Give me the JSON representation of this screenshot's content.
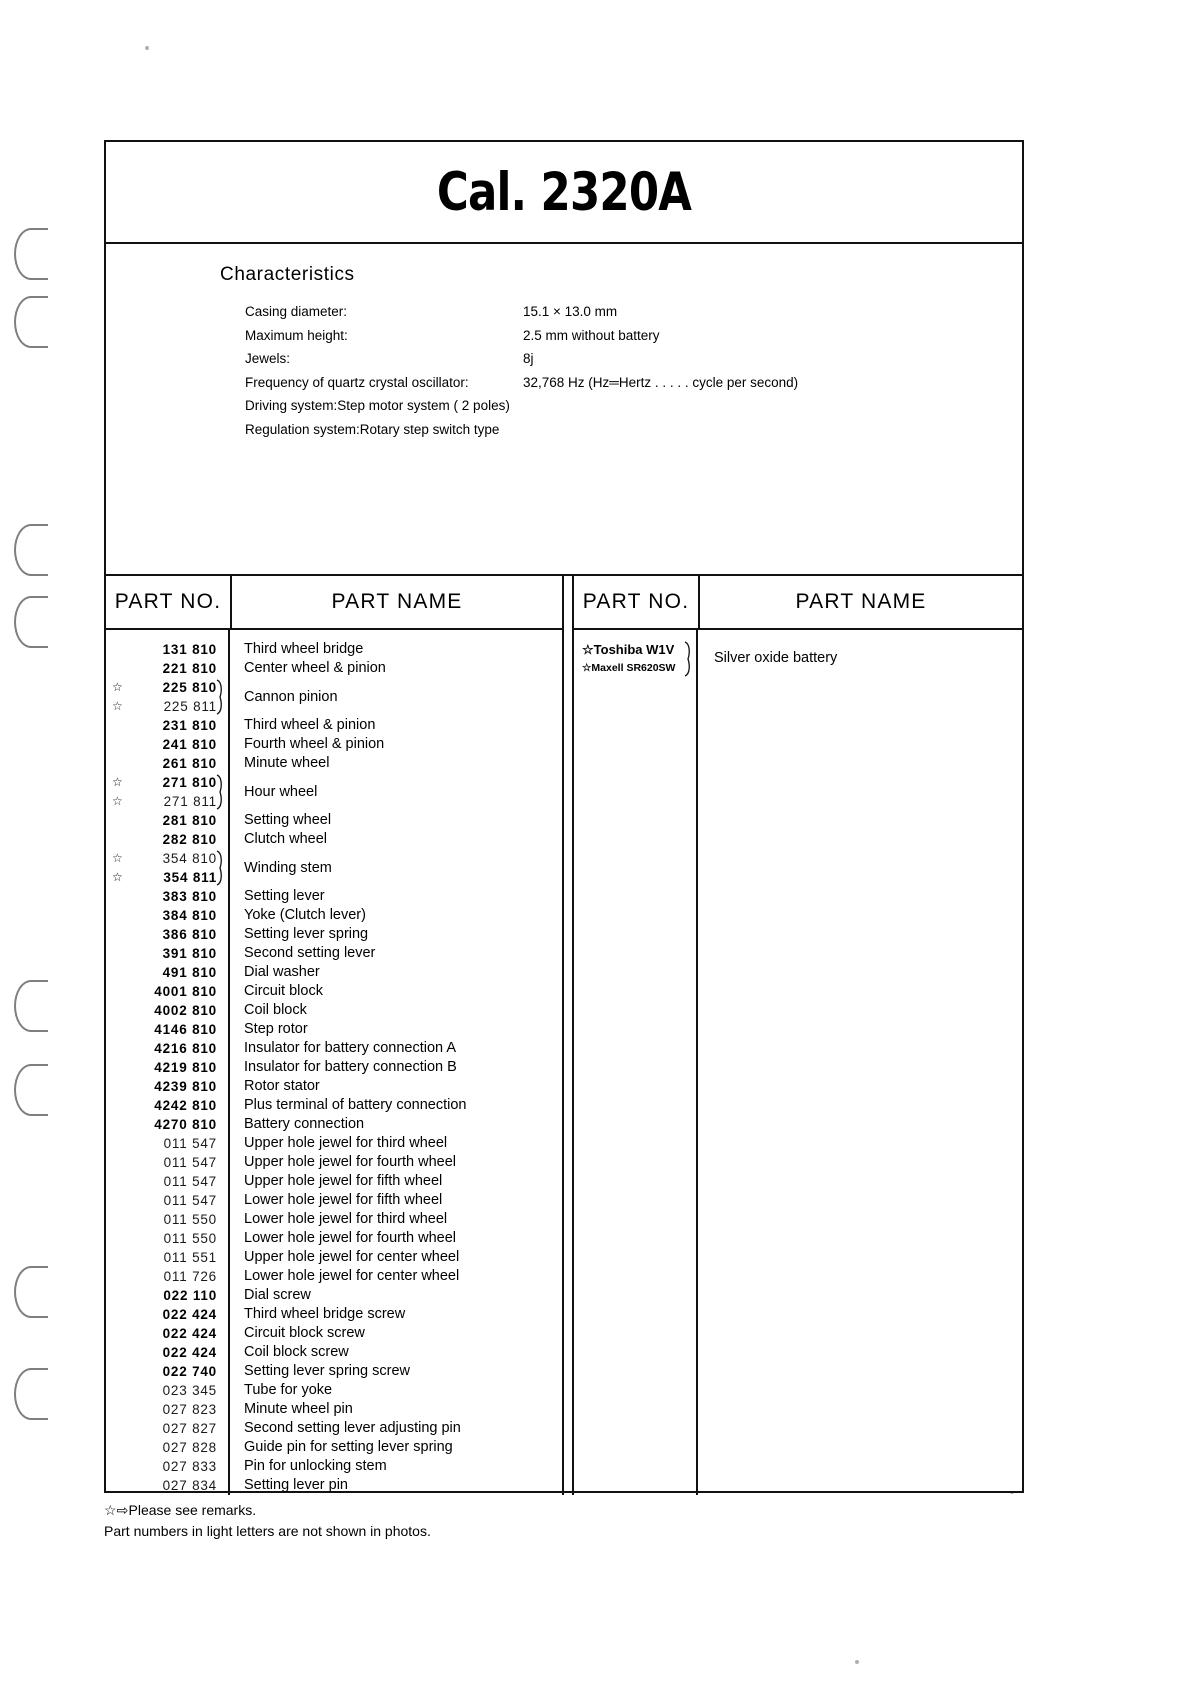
{
  "document": {
    "title": "Cal. 2320A"
  },
  "characteristics": {
    "heading": "Characteristics",
    "rows": [
      {
        "label": "Casing diameter:",
        "value": "15.1 × 13.0 mm",
        "full": false
      },
      {
        "label": "Maximum height:",
        "value": "2.5 mm without battery",
        "full": false
      },
      {
        "label": "Jewels:",
        "value": "8j",
        "full": false
      },
      {
        "label": "Frequency of quartz crystal oscillator:",
        "value": "32,768 Hz (Hz═Hertz . . . . . cycle per second)",
        "full": false
      },
      {
        "label": "Driving system:Step motor system ( 2 poles)",
        "value": "",
        "full": true
      },
      {
        "label": "Regulation system:Rotary step switch type",
        "value": "",
        "full": true
      }
    ]
  },
  "table": {
    "headers": {
      "part_no": "PART NO.",
      "part_name": "PART NAME"
    },
    "left_rows": [
      {
        "numbers": [
          {
            "text": "131 810",
            "weight": "bold",
            "star": false
          }
        ],
        "name": "Third wheel bridge",
        "grouped": false
      },
      {
        "numbers": [
          {
            "text": "221 810",
            "weight": "bold",
            "star": false
          }
        ],
        "name": "Center wheel & pinion",
        "grouped": false
      },
      {
        "numbers": [
          {
            "text": "225 810",
            "weight": "bold",
            "star": true
          },
          {
            "text": "225 811",
            "weight": "light",
            "star": true
          }
        ],
        "name": "Cannon pinion",
        "grouped": true
      },
      {
        "numbers": [
          {
            "text": "231 810",
            "weight": "bold",
            "star": false
          }
        ],
        "name": "Third wheel & pinion",
        "grouped": false
      },
      {
        "numbers": [
          {
            "text": "241 810",
            "weight": "bold",
            "star": false
          }
        ],
        "name": "Fourth wheel & pinion",
        "grouped": false
      },
      {
        "numbers": [
          {
            "text": "261 810",
            "weight": "bold",
            "star": false
          }
        ],
        "name": "Minute wheel",
        "grouped": false
      },
      {
        "numbers": [
          {
            "text": "271 810",
            "weight": "bold",
            "star": true
          },
          {
            "text": "271 811",
            "weight": "light",
            "star": true
          }
        ],
        "name": "Hour wheel",
        "grouped": true
      },
      {
        "numbers": [
          {
            "text": "281 810",
            "weight": "bold",
            "star": false
          }
        ],
        "name": "Setting wheel",
        "grouped": false
      },
      {
        "numbers": [
          {
            "text": "282 810",
            "weight": "bold",
            "star": false
          }
        ],
        "name": "Clutch wheel",
        "grouped": false
      },
      {
        "numbers": [
          {
            "text": "354 810",
            "weight": "light",
            "star": true
          },
          {
            "text": "354 811",
            "weight": "bold",
            "star": true
          }
        ],
        "name": "Winding stem",
        "grouped": true
      },
      {
        "numbers": [
          {
            "text": "383 810",
            "weight": "bold",
            "star": false
          }
        ],
        "name": "Setting lever",
        "grouped": false
      },
      {
        "numbers": [
          {
            "text": "384 810",
            "weight": "bold",
            "star": false
          }
        ],
        "name": "Yoke (Clutch lever)",
        "grouped": false
      },
      {
        "numbers": [
          {
            "text": "386 810",
            "weight": "bold",
            "star": false
          }
        ],
        "name": "Setting lever spring",
        "grouped": false
      },
      {
        "numbers": [
          {
            "text": "391 810",
            "weight": "bold",
            "star": false
          }
        ],
        "name": "Second setting lever",
        "grouped": false
      },
      {
        "numbers": [
          {
            "text": "491 810",
            "weight": "bold",
            "star": false
          }
        ],
        "name": "Dial washer",
        "grouped": false
      },
      {
        "numbers": [
          {
            "text": "4001 810",
            "weight": "bold",
            "star": false
          }
        ],
        "name": "Circuit block",
        "grouped": false
      },
      {
        "numbers": [
          {
            "text": "4002 810",
            "weight": "bold",
            "star": false
          }
        ],
        "name": "Coil block",
        "grouped": false
      },
      {
        "numbers": [
          {
            "text": "4146 810",
            "weight": "bold",
            "star": false
          }
        ],
        "name": "Step rotor",
        "grouped": false
      },
      {
        "numbers": [
          {
            "text": "4216 810",
            "weight": "bold",
            "star": false
          }
        ],
        "name": "Insulator for battery connection A",
        "grouped": false
      },
      {
        "numbers": [
          {
            "text": "4219 810",
            "weight": "bold",
            "star": false
          }
        ],
        "name": "Insulator for battery connection B",
        "grouped": false
      },
      {
        "numbers": [
          {
            "text": "4239 810",
            "weight": "bold",
            "star": false
          }
        ],
        "name": "Rotor stator",
        "grouped": false
      },
      {
        "numbers": [
          {
            "text": "4242 810",
            "weight": "bold",
            "star": false
          }
        ],
        "name": "Plus terminal of battery connection",
        "grouped": false
      },
      {
        "numbers": [
          {
            "text": "4270 810",
            "weight": "bold",
            "star": false
          }
        ],
        "name": "Battery connection",
        "grouped": false
      },
      {
        "numbers": [
          {
            "text": "011 547",
            "weight": "light",
            "star": false
          }
        ],
        "name": "Upper hole jewel for third wheel",
        "grouped": false
      },
      {
        "numbers": [
          {
            "text": "011 547",
            "weight": "light",
            "star": false
          }
        ],
        "name": "Upper hole jewel for fourth wheel",
        "grouped": false
      },
      {
        "numbers": [
          {
            "text": "011 547",
            "weight": "light",
            "star": false
          }
        ],
        "name": "Upper hole jewel for fifth wheel",
        "grouped": false
      },
      {
        "numbers": [
          {
            "text": "011 547",
            "weight": "light",
            "star": false
          }
        ],
        "name": "Lower hole jewel for fifth wheel",
        "grouped": false
      },
      {
        "numbers": [
          {
            "text": "011 550",
            "weight": "light",
            "star": false
          }
        ],
        "name": "Lower hole jewel for third wheel",
        "grouped": false
      },
      {
        "numbers": [
          {
            "text": "011 550",
            "weight": "light",
            "star": false
          }
        ],
        "name": "Lower hole jewel for fourth wheel",
        "grouped": false
      },
      {
        "numbers": [
          {
            "text": "011 551",
            "weight": "light",
            "star": false
          }
        ],
        "name": "Upper hole jewel for center wheel",
        "grouped": false
      },
      {
        "numbers": [
          {
            "text": "011 726",
            "weight": "light",
            "star": false
          }
        ],
        "name": "Lower hole jewel for center wheel",
        "grouped": false
      },
      {
        "numbers": [
          {
            "text": "022 110",
            "weight": "bold",
            "star": false
          }
        ],
        "name": "Dial screw",
        "grouped": false
      },
      {
        "numbers": [
          {
            "text": "022 424",
            "weight": "bold",
            "star": false
          }
        ],
        "name": "Third wheel bridge screw",
        "grouped": false
      },
      {
        "numbers": [
          {
            "text": "022 424",
            "weight": "bold",
            "star": false
          }
        ],
        "name": "Circuit block screw",
        "grouped": false
      },
      {
        "numbers": [
          {
            "text": "022 424",
            "weight": "bold",
            "star": false
          }
        ],
        "name": "Coil block screw",
        "grouped": false
      },
      {
        "numbers": [
          {
            "text": "022 740",
            "weight": "bold",
            "star": false
          }
        ],
        "name": "Setting lever spring screw",
        "grouped": false
      },
      {
        "numbers": [
          {
            "text": "023 345",
            "weight": "light",
            "star": false
          }
        ],
        "name": "Tube for yoke",
        "grouped": false
      },
      {
        "numbers": [
          {
            "text": "027 823",
            "weight": "light",
            "star": false
          }
        ],
        "name": "Minute wheel pin",
        "grouped": false
      },
      {
        "numbers": [
          {
            "text": "027 827",
            "weight": "light",
            "star": false
          }
        ],
        "name": "Second setting lever adjusting pin",
        "grouped": false
      },
      {
        "numbers": [
          {
            "text": "027 828",
            "weight": "light",
            "star": false
          }
        ],
        "name": "Guide pin for setting lever spring",
        "grouped": false
      },
      {
        "numbers": [
          {
            "text": "027 833",
            "weight": "light",
            "star": false
          }
        ],
        "name": "Pin for unlocking stem",
        "grouped": false
      },
      {
        "numbers": [
          {
            "text": "027 834",
            "weight": "light",
            "star": false
          }
        ],
        "name": "Setting lever pin",
        "grouped": false
      }
    ],
    "right_rows": [
      {
        "numbers": [
          {
            "text": "Toshiba W1V",
            "weight": "bold",
            "star": true,
            "size": "b1"
          },
          {
            "text": "Maxell SR620SW",
            "weight": "bold",
            "star": true,
            "size": "b2"
          }
        ],
        "name": "Silver oxide battery",
        "grouped": true
      }
    ]
  },
  "footer": {
    "star_symbol": "☆",
    "arrow_symbol": "⇨",
    "note_1": "Please see remarks.",
    "note_2": "Part numbers in light letters are not shown in photos."
  }
}
